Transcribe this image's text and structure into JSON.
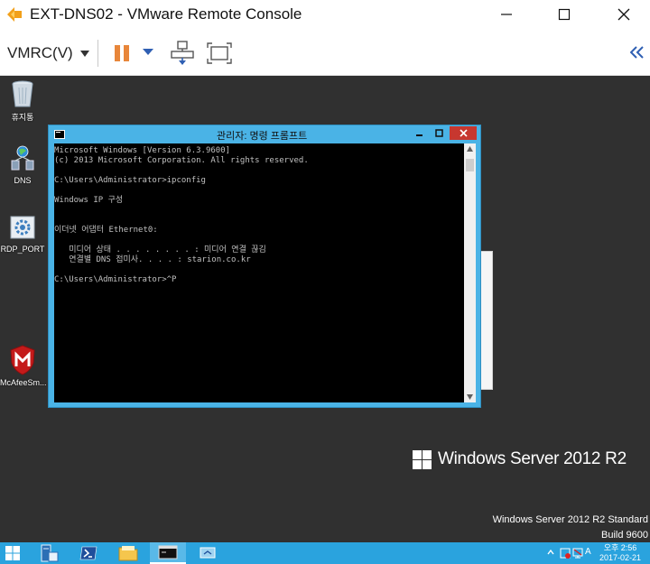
{
  "window": {
    "title": "EXT-DNS02 - VMware Remote Console"
  },
  "toolbar": {
    "menu_label": "VMRC(V)"
  },
  "desktop": {
    "icons": [
      {
        "label": "휴지통"
      },
      {
        "label": "DNS"
      },
      {
        "label": "RDP_PORT"
      },
      {
        "label": "McAfeeSm..."
      }
    ],
    "brand": "Windows Server 2012 R2",
    "watermark_line1": "Windows Server 2012 R2 Standard",
    "watermark_line2": "Build 9600"
  },
  "cmd": {
    "title": "관리자: 명령 프롬프트",
    "lines": [
      "Microsoft Windows [Version 6.3.9600]",
      "(c) 2013 Microsoft Corporation. All rights reserved.",
      "",
      "C:\\Users\\Administrator>ipconfig",
      "",
      "Windows IP 구성",
      "",
      "",
      "이더넷 어댑터 Ethernet0:",
      "",
      "   미디어 상태 . . . . . . . . : 미디어 연결 끊김",
      "   연결별 DNS 접미사. . . . : starion.co.kr",
      "",
      "C:\\Users\\Administrator>^P"
    ]
  },
  "taskbar": {
    "clock_time": "오후 2:56",
    "clock_date": "2017-02-21",
    "ime_label": "A"
  },
  "colors": {
    "accent": "#2aa3de",
    "pause": "#e8863a",
    "vmrc_blue": "#2f5fb3",
    "desktop_bg": "#303030"
  }
}
